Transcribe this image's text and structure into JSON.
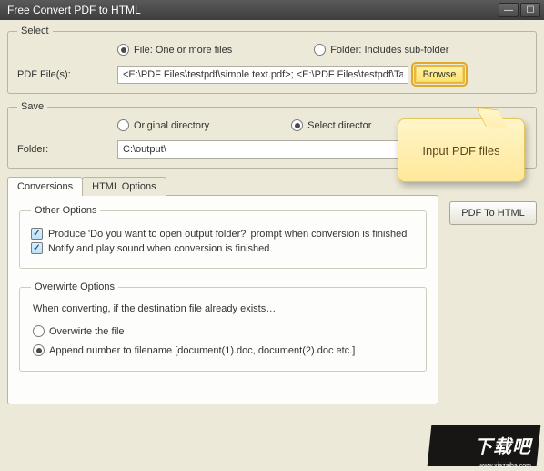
{
  "window": {
    "title": "Free Convert PDF to HTML"
  },
  "select": {
    "legend": "Select",
    "file_radio": "File:  One or more files",
    "folder_radio": "Folder: Includes sub-folder",
    "pdf_label": "PDF File(s):",
    "pdf_value": "<E:\\PDF Files\\testpdf\\simple text.pdf>; <E:\\PDF Files\\testpdf\\Table.pdf>; <E:\\PDF",
    "browse": "Browse"
  },
  "save": {
    "legend": "Save",
    "original_radio": "Original directory",
    "select_radio": "Select director",
    "folder_label": "Folder:",
    "folder_value": "C:\\output\\"
  },
  "tabs": {
    "conversions": "Conversions",
    "html_options": "HTML Options"
  },
  "other": {
    "legend": "Other Options",
    "opt1": "Produce 'Do you want to open output folder?' prompt when conversion is finished",
    "opt2": "Notify and play sound when conversion is finished"
  },
  "overwrite": {
    "legend": "Overwirte Options",
    "desc": "When converting, if the destination file already exists…",
    "opt1": "Overwirte the file",
    "opt2": "Append number to filename  [document(1).doc, document(2).doc etc.]"
  },
  "action": {
    "convert": "PDF To HTML"
  },
  "callout": {
    "text": "Input PDF files"
  },
  "watermark": {
    "brand": "下载吧",
    "url": "www.xiazaiba.com"
  }
}
